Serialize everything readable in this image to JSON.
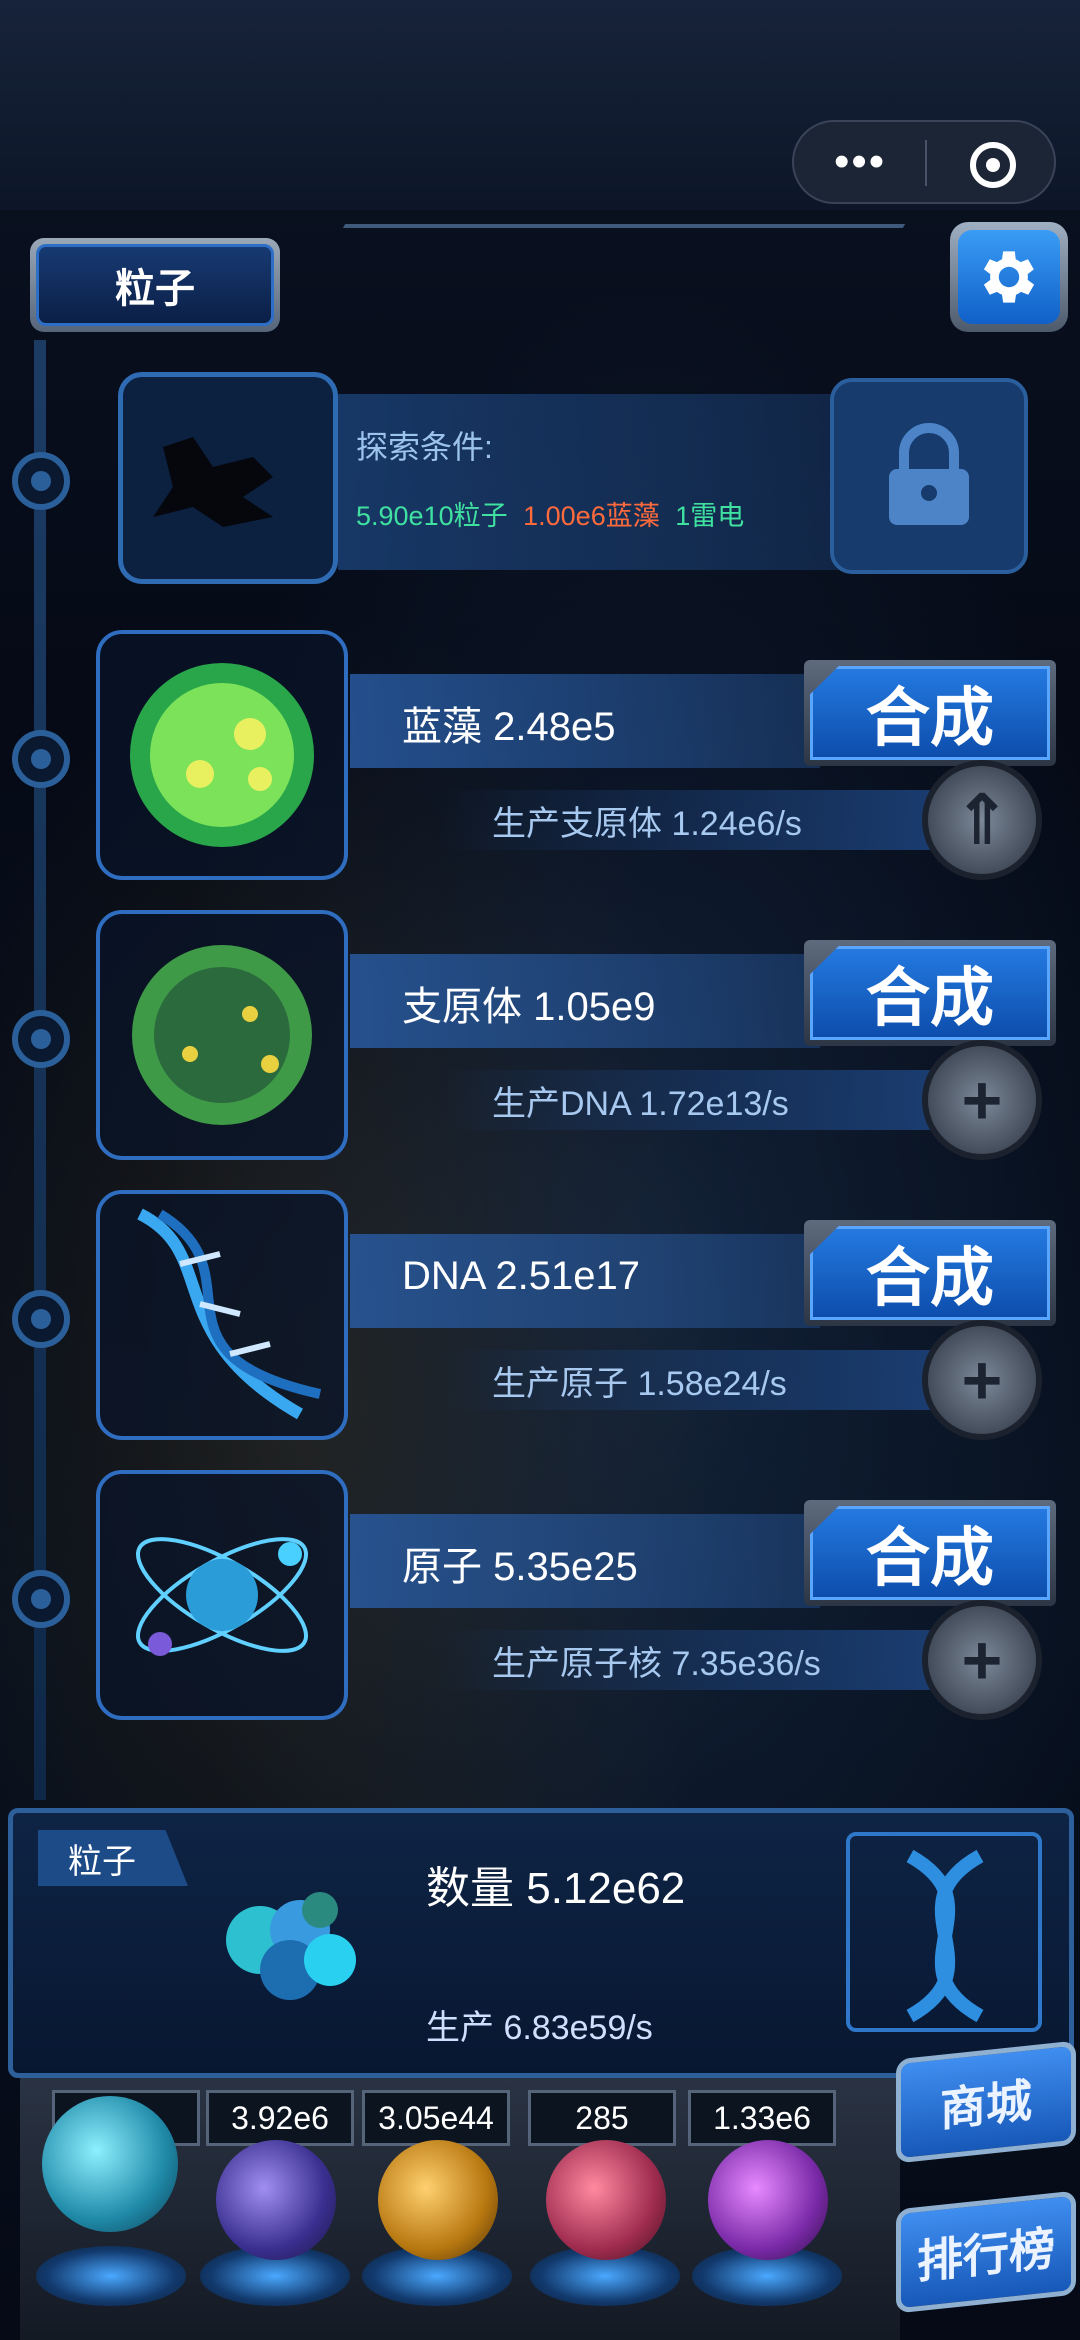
{
  "header": {
    "title": "粒子"
  },
  "locked": {
    "condition_label": "探索条件:",
    "conditions": [
      {
        "text": "5.90e10粒子",
        "color": "#3fe0a0"
      },
      {
        "text": "1.00e6蓝藻",
        "color": "#ff6a3c"
      },
      {
        "text": "1雷电",
        "color": "#3fe0a0"
      }
    ]
  },
  "items": [
    {
      "name": "蓝藻 2.48e5",
      "production": "生产支原体 1.24e6/s",
      "button": "合成",
      "upgrade_icon": "upgrade-icon",
      "icon": "cyanobacteria-icon"
    },
    {
      "name": "支原体 1.05e9",
      "production": "生产DNA 1.72e13/s",
      "button": "合成",
      "upgrade_icon": "plus-icon",
      "icon": "mycoplasma-icon"
    },
    {
      "name": "DNA 2.51e17",
      "production": "生产原子 1.58e24/s",
      "button": "合成",
      "upgrade_icon": "plus-icon",
      "icon": "dna-icon"
    },
    {
      "name": "原子 5.35e25",
      "production": "生产原子核 7.35e36/s",
      "button": "合成",
      "upgrade_icon": "plus-icon",
      "icon": "atom-icon"
    }
  ],
  "panel": {
    "label": "粒子",
    "quantity": "数量 5.12e62",
    "production": "生产 6.83e59/s"
  },
  "resources": [
    {
      "value": "2",
      "orb_color": "#2fb6c8"
    },
    {
      "value": "3.92e6",
      "orb_color": "#4a3fa0"
    },
    {
      "value": "3.05e44",
      "orb_color": "#c88a20"
    },
    {
      "value": "285",
      "orb_color": "#b03a60"
    },
    {
      "value": "1.33e6",
      "orb_color": "#8a2fb0"
    }
  ],
  "side": {
    "shop": "商城",
    "ranking": "排行榜"
  }
}
